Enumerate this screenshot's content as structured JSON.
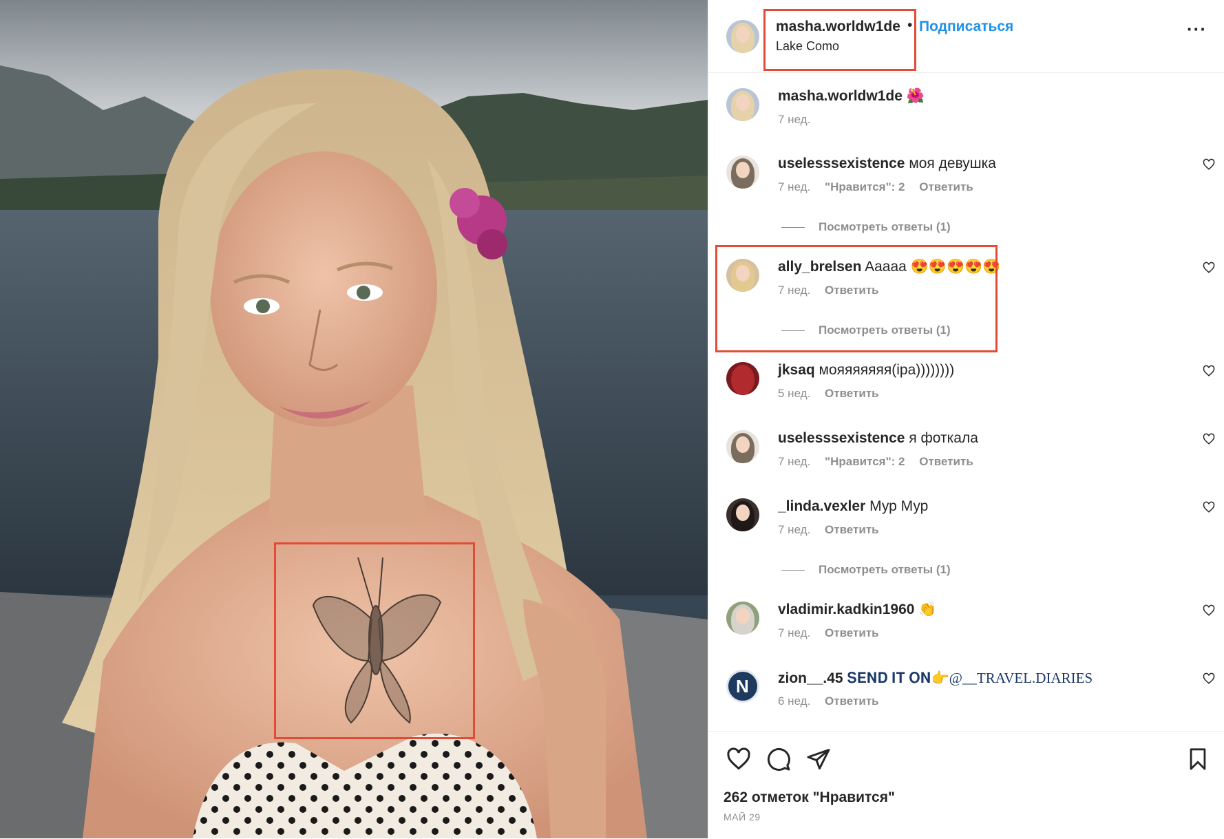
{
  "post": {
    "author": "masha.worldw1de",
    "separator": "•",
    "follow_label": "Подписаться",
    "location": "Lake Como",
    "more_icon": "more-horizontal-icon",
    "more_label": "···"
  },
  "comments": [
    {
      "user": "masha.worldw1de",
      "text": "🌺",
      "time": "7 нед.",
      "likes": "",
      "reply": ""
    },
    {
      "user": "uselesssexistence",
      "text": "моя девушка",
      "time": "7 нед.",
      "likes": "\"Нравится\": 2",
      "reply": "Ответить",
      "replies": "Посмотреть ответы (1)"
    },
    {
      "user": "ally_brelsen",
      "text": "Aaaaa 😍😍😍😍😍",
      "time": "7 нед.",
      "likes": "",
      "reply": "Ответить",
      "replies": "Посмотреть ответы (1)"
    },
    {
      "user": "jksaq",
      "text": "мояяяяяяя(ipa))))))))",
      "time": "5 нед.",
      "likes": "",
      "reply": "Ответить"
    },
    {
      "user": "uselesssexistence",
      "text": "я фоткала",
      "time": "7 нед.",
      "likes": "\"Нравится\": 2",
      "reply": "Ответить"
    },
    {
      "user": "_linda.vexler",
      "text": "Мур Мур",
      "time": "7 нед.",
      "likes": "",
      "reply": "Ответить",
      "replies": "Посмотреть ответы (1)"
    },
    {
      "user": "vladimir.kadkin1960",
      "text": "👏",
      "time": "7 нед.",
      "likes": "",
      "reply": "Ответить"
    },
    {
      "user": "zion__.45",
      "text": "𝐒𝐄𝐍𝐃 𝐈𝐓 𝐎𝐍👉@__TRAVEL.DIARIES",
      "time": "6 нед.",
      "likes": "",
      "reply": "Ответить"
    }
  ],
  "footer": {
    "likes_count": "262 отметок \"Нравится\"",
    "date": "МАЙ 29",
    "icons": [
      "heart-icon",
      "comment-icon",
      "share-icon",
      "bookmark-icon"
    ]
  },
  "colors": {
    "accent": "#1f91e8",
    "highlight_box": "#e24b36",
    "secondary_text": "#8e8e8e"
  }
}
